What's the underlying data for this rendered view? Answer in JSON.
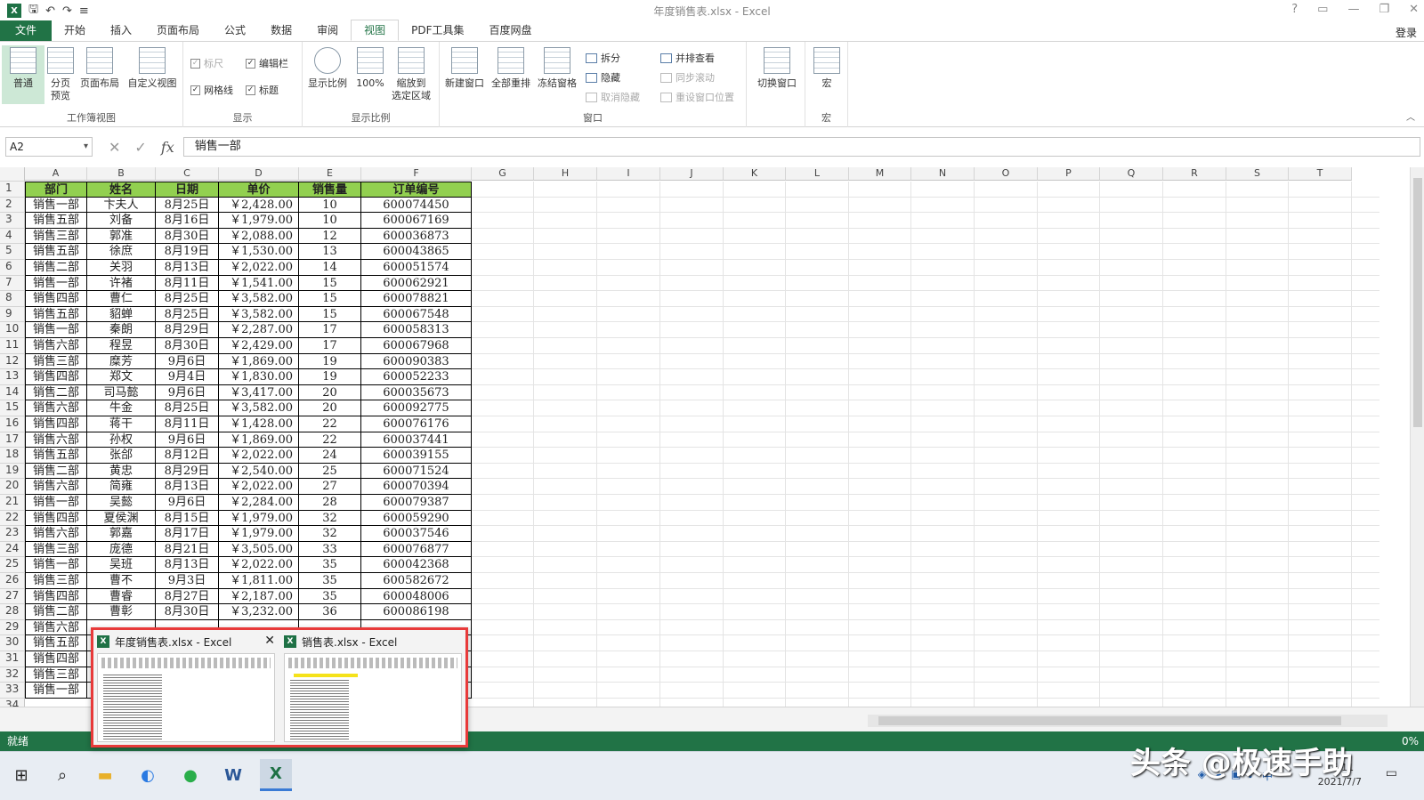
{
  "window": {
    "title": "年度销售表.xlsx - Excel",
    "app_icon": "X",
    "controls": [
      "?",
      "▭",
      "—",
      "❐",
      "✕"
    ],
    "login": "登录"
  },
  "ribbon_tabs": [
    "文件",
    "开始",
    "插入",
    "页面布局",
    "公式",
    "数据",
    "审阅",
    "视图",
    "PDF工具集",
    "百度网盘"
  ],
  "active_tab": "视图",
  "ribbon": {
    "workbook_views": {
      "label": "工作簿视图",
      "normal": "普通",
      "page_break": "分页\n预览",
      "page_layout": "页面布局",
      "custom_views": "自定义视图"
    },
    "show": {
      "label": "显示",
      "ruler": "标尺",
      "formula_bar": "编辑栏",
      "gridlines": "网格线",
      "headings": "标题"
    },
    "zoom": {
      "label": "显示比例",
      "zoom": "显示比例",
      "hundred": "100%",
      "zoom_selection": "缩放到\n选定区域"
    },
    "window_group": {
      "label": "窗口",
      "new_window": "新建窗口",
      "arrange_all": "全部重排",
      "freeze_panes": "冻结窗格",
      "split": "拆分",
      "hide": "隐藏",
      "unhide": "取消隐藏",
      "side_by_side": "并排查看",
      "sync_scroll": "同步滚动",
      "reset_position": "重设窗口位置",
      "switch_windows": "切换窗口"
    },
    "macros": {
      "label": "宏",
      "macros": "宏"
    }
  },
  "formula_bar": {
    "name_box": "A2",
    "cancel": "✕",
    "enter": "✓",
    "fx": "fx",
    "value": "销售一部"
  },
  "columns": [
    "A",
    "B",
    "C",
    "D",
    "E",
    "F",
    "G",
    "H",
    "I",
    "J",
    "K",
    "L",
    "M",
    "N",
    "O",
    "P",
    "Q",
    "R",
    "S",
    "T"
  ],
  "headers": [
    "部门",
    "姓名",
    "日期",
    "单价",
    "销售量",
    "订单编号"
  ],
  "rows": [
    [
      "销售一部",
      "卞夫人",
      "8月25日",
      "￥2,428.00",
      "10",
      "600074450"
    ],
    [
      "销售五部",
      "刘备",
      "8月16日",
      "￥1,979.00",
      "10",
      "600067169"
    ],
    [
      "销售三部",
      "郭准",
      "8月30日",
      "￥2,088.00",
      "12",
      "600036873"
    ],
    [
      "销售五部",
      "徐庶",
      "8月19日",
      "￥1,530.00",
      "13",
      "600043865"
    ],
    [
      "销售二部",
      "关羽",
      "8月13日",
      "￥2,022.00",
      "14",
      "600051574"
    ],
    [
      "销售一部",
      "许褚",
      "8月11日",
      "￥1,541.00",
      "15",
      "600062921"
    ],
    [
      "销售四部",
      "曹仁",
      "8月25日",
      "￥3,582.00",
      "15",
      "600078821"
    ],
    [
      "销售五部",
      "貂蝉",
      "8月25日",
      "￥3,582.00",
      "15",
      "600067548"
    ],
    [
      "销售一部",
      "秦朗",
      "8月29日",
      "￥2,287.00",
      "17",
      "600058313"
    ],
    [
      "销售六部",
      "程昱",
      "8月30日",
      "￥2,429.00",
      "17",
      "600067968"
    ],
    [
      "销售三部",
      "糜芳",
      "9月6日",
      "￥1,869.00",
      "19",
      "600090383"
    ],
    [
      "销售四部",
      "郑文",
      "9月4日",
      "￥1,830.00",
      "19",
      "600052233"
    ],
    [
      "销售二部",
      "司马懿",
      "9月6日",
      "￥3,417.00",
      "20",
      "600035673"
    ],
    [
      "销售六部",
      "牛金",
      "8月25日",
      "￥3,582.00",
      "20",
      "600092775"
    ],
    [
      "销售四部",
      "蒋干",
      "8月11日",
      "￥1,428.00",
      "22",
      "600076176"
    ],
    [
      "销售六部",
      "孙权",
      "9月6日",
      "￥1,869.00",
      "22",
      "600037441"
    ],
    [
      "销售五部",
      "张郃",
      "8月12日",
      "￥2,022.00",
      "24",
      "600039155"
    ],
    [
      "销售二部",
      "黄忠",
      "8月29日",
      "￥2,540.00",
      "25",
      "600071524"
    ],
    [
      "销售六部",
      "简雍",
      "8月13日",
      "￥2,022.00",
      "27",
      "600070394"
    ],
    [
      "销售一部",
      "吴懿",
      "9月6日",
      "￥2,284.00",
      "28",
      "600079387"
    ],
    [
      "销售四部",
      "夏侯渊",
      "8月15日",
      "￥1,979.00",
      "32",
      "600059290"
    ],
    [
      "销售六部",
      "郭嘉",
      "8月17日",
      "￥1,979.00",
      "32",
      "600037546"
    ],
    [
      "销售三部",
      "庞德",
      "8月21日",
      "￥3,505.00",
      "33",
      "600076877"
    ],
    [
      "销售一部",
      "吴班",
      "8月13日",
      "￥2,022.00",
      "35",
      "600042368"
    ],
    [
      "销售三部",
      "曹不",
      "9月3日",
      "￥1,811.00",
      "35",
      "600582672"
    ],
    [
      "销售四部",
      "曹睿",
      "8月27日",
      "￥2,187.00",
      "35",
      "600048006"
    ],
    [
      "销售二部",
      "曹彰",
      "8月30日",
      "￥3,232.00",
      "36",
      "600086198"
    ],
    [
      "销售六部",
      "",
      "",
      "",
      "",
      ""
    ],
    [
      "销售五部",
      "",
      "",
      "",
      "",
      ""
    ],
    [
      "销售四部",
      "",
      "",
      "",
      "",
      ""
    ],
    [
      "销售三部",
      "",
      "",
      "",
      "",
      ""
    ],
    [
      "销售一部",
      "",
      "",
      "",
      "",
      ""
    ]
  ],
  "status": {
    "ready": "就绪",
    "zoom": "0%"
  },
  "taskbar_popup": {
    "windows": [
      {
        "title": "年度销售表.xlsx - Excel"
      },
      {
        "title": "销售表.xlsx - Excel"
      }
    ]
  },
  "taskbar": {
    "time": "16:11",
    "date": "2021/7/7",
    "ime": "中"
  },
  "watermark": "头条 @极速手助"
}
